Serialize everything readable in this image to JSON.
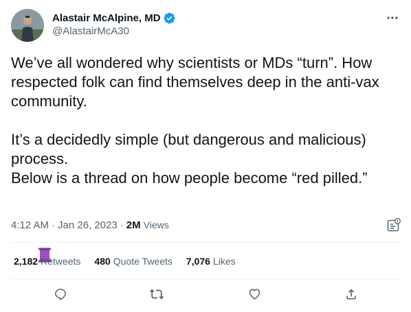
{
  "author": {
    "display_name": "Alastair McAlpine, MD",
    "handle": "@AlastairMcA30",
    "verified_icon": "verified-badge-icon",
    "verified_color": "#1d9bf0"
  },
  "tweet": {
    "paragraph_1": "We’ve all wondered why scientists or MDs “turn”. How respected folk can find themselves deep in the anti-vax community.",
    "paragraph_2_line_1": "It’s a decidedly simple (but dangerous and malicious) process.",
    "paragraph_2_line_2": "Below is a thread on how people become “red pilled.”",
    "emoji": "🧵",
    "emoji_icon": "thread-spool-icon"
  },
  "meta": {
    "time": "4:12 AM",
    "separator": "·",
    "date": "Jan 26, 2023",
    "views_count": "2M",
    "views_label": "Views"
  },
  "stats": {
    "retweets_count": "2,182",
    "retweets_label": "Retweets",
    "quotes_count": "480",
    "quotes_label": "Quote Tweets",
    "likes_count": "7,076",
    "likes_label": "Likes"
  },
  "actions": {
    "reply_icon": "reply-icon",
    "retweet_icon": "retweet-icon",
    "like_icon": "heart-icon",
    "share_icon": "share-icon",
    "more_icon": "more-options-icon",
    "analytics_icon": "analytics-icon",
    "icon_color": "#536471"
  }
}
